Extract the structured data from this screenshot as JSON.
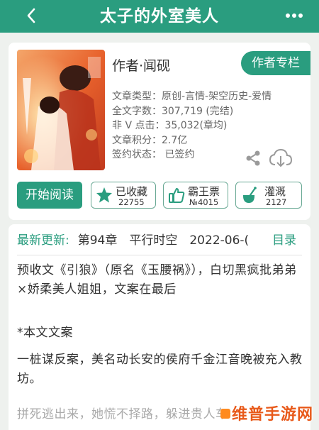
{
  "header": {
    "title": "太子的外室美人",
    "back_icon": "chevron-left-icon",
    "more_icon": "more-dots-icon",
    "color": "#2a9d7f"
  },
  "book": {
    "author": "作者·闻砚",
    "author_column_label": "作者专栏",
    "meta": [
      "文章类型：原创-言情-架空历史-爱情",
      "全文字数：307,719 (完结)",
      "非 V 点击：35,032(章均)",
      "文章积分：2.7亿",
      "签约状态： 已签约"
    ],
    "share_icon": "share-icon",
    "download_icon": "cloud-download-icon"
  },
  "actions": {
    "start_reading": "开始阅读",
    "collect": {
      "label": "已收藏",
      "count": "22755",
      "icon": "star-icon"
    },
    "vote": {
      "label": "霸王票",
      "count": "№4015",
      "icon": "thumbs-up-icon"
    },
    "water": {
      "label": "灌溉",
      "count": "2127",
      "icon": "nutrient-bottle-icon"
    }
  },
  "content": {
    "latest_label": "最新更新:",
    "latest_chapter": "第94章　平行时空　2022-06-(",
    "catalog_label": "目录",
    "paragraphs": [
      "预收文《引狼》（原名《玉腰祸》），白切黑疯批弟弟×娇柔美人姐姐，文案在最后",
      "*本文文案",
      "一桩谋反案，美名动长安的侯府千金江音晚被充入教坊。",
      "拼死逃出来，她慌不择路，躲进贵人车"
    ]
  },
  "watermark": "维普手游网",
  "accent_color": "#2a9d7f"
}
